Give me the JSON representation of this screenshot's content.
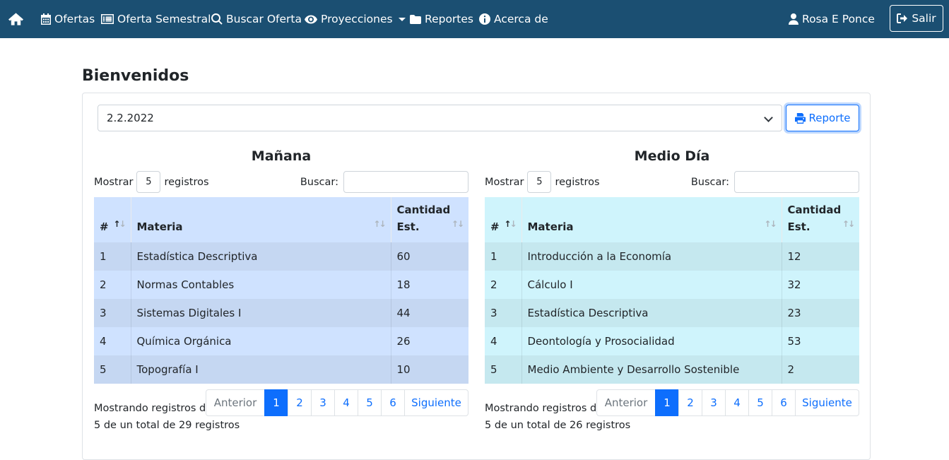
{
  "nav": {
    "items": [
      {
        "icon": "home-icon",
        "label": ""
      },
      {
        "icon": "calendar-icon",
        "label": "Ofertas"
      },
      {
        "icon": "list-alt-icon",
        "label": "Oferta Semestral"
      },
      {
        "icon": "search-icon",
        "label": "Buscar Oferta"
      },
      {
        "icon": "eye-icon",
        "label": "Proyecciones"
      },
      {
        "icon": "folder-icon",
        "label": "Reportes"
      },
      {
        "icon": "info-circle-icon",
        "label": "Acerca de"
      }
    ],
    "user": "Rosa E Ponce",
    "logout": "Salir"
  },
  "page": {
    "title": "Bienvenidos",
    "select_value": "2.2.2022",
    "report_button": "Reporte"
  },
  "tables": [
    {
      "title": "Mañana",
      "show_label": "Mostrar",
      "show_value": "5",
      "records_label": "registros",
      "search_label": "Buscar:",
      "headers": [
        "#",
        "Materia",
        "Cantidad Est."
      ],
      "rows": [
        [
          "1",
          "Estadística Descriptiva",
          "60"
        ],
        [
          "2",
          "Normas Contables",
          "18"
        ],
        [
          "3",
          "Sistemas Digitales I",
          "44"
        ],
        [
          "4",
          "Química Orgánica",
          "26"
        ],
        [
          "5",
          "Topografía I",
          "10"
        ]
      ],
      "info_line1": "Mostrando registros del 1 al",
      "info_line2": "5 de un total de 29 registros",
      "pager": {
        "prev": "Anterior",
        "pages": [
          "1",
          "2",
          "3",
          "4",
          "5",
          "6"
        ],
        "active": "1",
        "next": "Siguiente"
      }
    },
    {
      "title": "Medio Día",
      "show_label": "Mostrar",
      "show_value": "5",
      "records_label": "registros",
      "search_label": "Buscar:",
      "headers": [
        "#",
        "Materia",
        "Cantidad Est."
      ],
      "rows": [
        [
          "1",
          "Introducción a la Economía",
          "12"
        ],
        [
          "2",
          "Cálculo I",
          "32"
        ],
        [
          "3",
          "Estadística Descriptiva",
          "23"
        ],
        [
          "4",
          "Deontología y Prosocialidad",
          "53"
        ],
        [
          "5",
          "Medio Ambiente y Desarrollo Sostenible",
          "2"
        ]
      ],
      "info_line1": "Mostrando registros del 1 al",
      "info_line2": "5 de un total de 26 registros",
      "pager": {
        "prev": "Anterior",
        "pages": [
          "1",
          "2",
          "3",
          "4",
          "5",
          "6"
        ],
        "active": "1",
        "next": "Siguiente"
      }
    }
  ],
  "colors": {
    "navbar": "#1b4f72",
    "primary": "#0d6efd",
    "table_blue": "#cfe2ff",
    "table_cyan": "#cff4fc"
  }
}
